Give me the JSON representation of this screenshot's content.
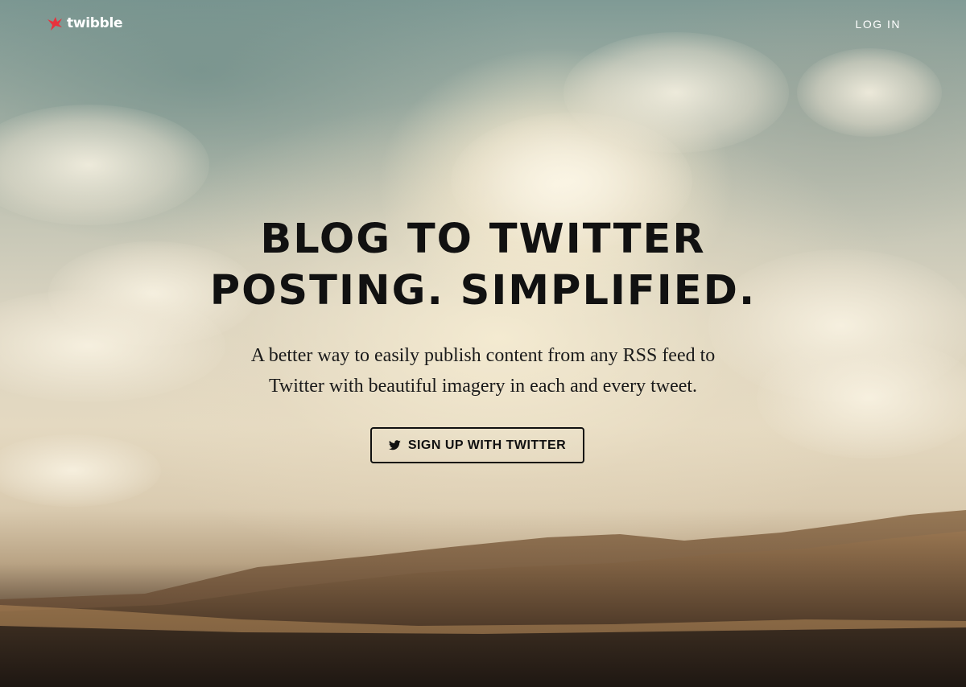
{
  "brand": {
    "name": "twibble",
    "logo_icon": "twibble-bird-logo",
    "accent_color": "#e8323c"
  },
  "nav": {
    "login_label": "LOG IN"
  },
  "hero": {
    "headline_line1": "BLOG TO TWITTER",
    "headline_line2": "POSTING. SIMPLIFIED.",
    "subhead_line1": "A better way to easily publish content from any RSS feed to",
    "subhead_line2": "Twitter with beautiful imagery in each and every tweet.",
    "cta_label": "SIGN UP WITH TWITTER",
    "cta_icon": "twitter-bird-icon",
    "background": "desert-dunes-sky-photo"
  }
}
